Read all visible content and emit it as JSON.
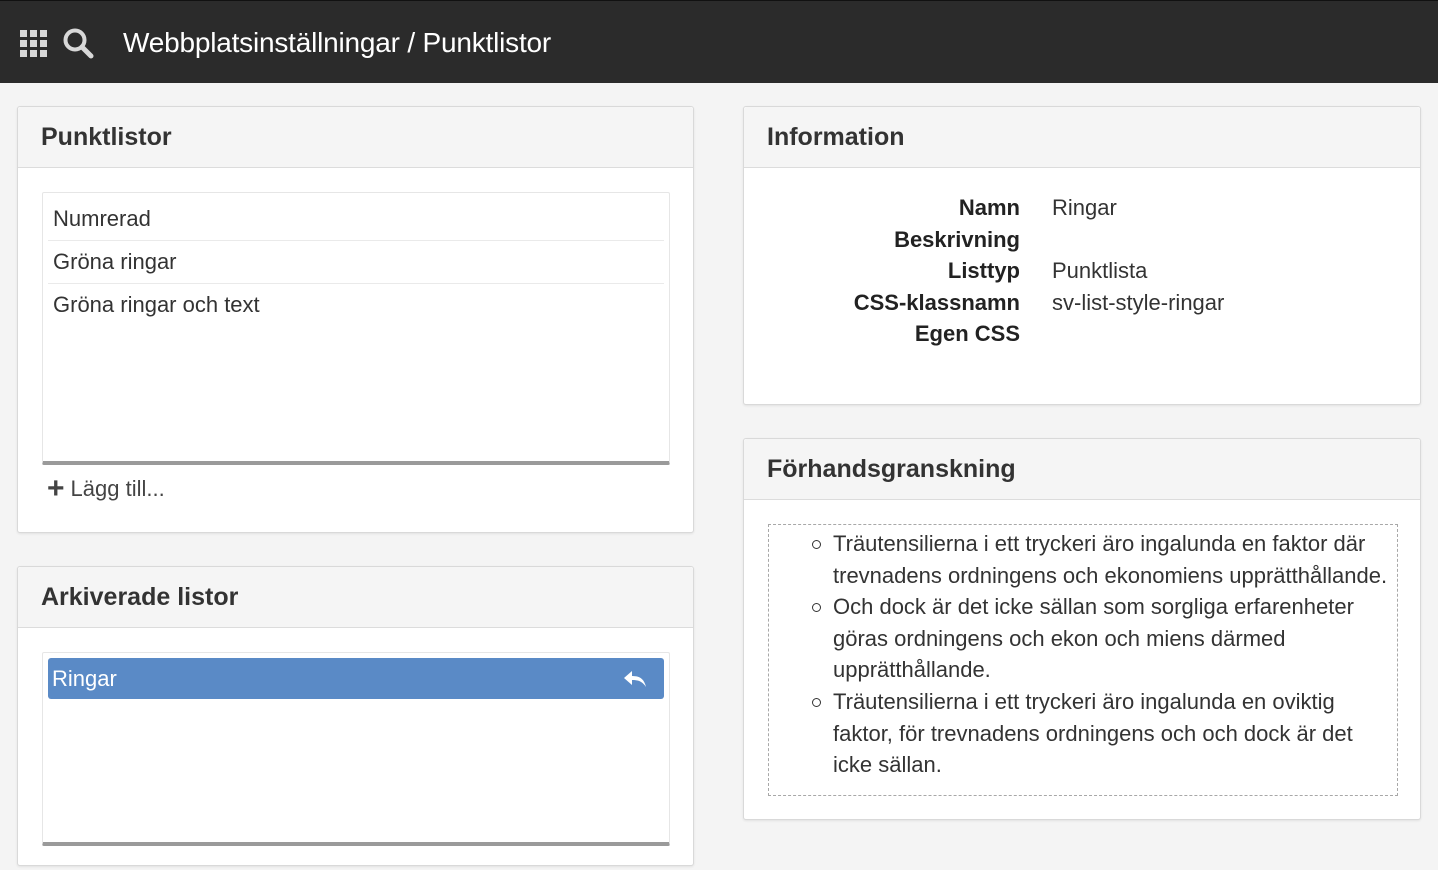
{
  "topbar": {
    "title": "Webbplatsinställningar / Punktlistor",
    "icons": [
      "grid-icon",
      "search-icon"
    ]
  },
  "lists_panel": {
    "title": "Punktlistor",
    "items": [
      "Numrerad",
      "Gröna ringar",
      "Gröna ringar och text"
    ],
    "add_label": "Lägg till..."
  },
  "archived_panel": {
    "title": "Arkiverade listor",
    "items": [
      {
        "label": "Ringar",
        "selected": true,
        "action_icon": "restore-icon"
      }
    ]
  },
  "info_panel": {
    "title": "Information",
    "rows": [
      {
        "label": "Namn",
        "value": "Ringar"
      },
      {
        "label": "Beskrivning",
        "value": ""
      },
      {
        "label": "Listtyp",
        "value": "Punktlista"
      },
      {
        "label": "CSS-klassnamn",
        "value": "sv-list-style-ringar"
      },
      {
        "label": "Egen CSS",
        "value": ""
      }
    ]
  },
  "preview_panel": {
    "title": "Förhandsgranskning",
    "bullets": [
      "Träutensilierna i ett tryckeri äro ingalunda en faktor där trevnadens ordningens och ekonomiens upprätthållande.",
      "Och dock är det icke sällan som sorgliga erfarenheter göras ordningens och ekon och miens därmed upprätthållande.",
      "Träutensilierna i ett tryckeri äro ingalunda en oviktig faktor, för trevnadens ordningens och och dock är det icke sällan."
    ]
  },
  "colors": {
    "topbar_bg": "#2b2b2b",
    "selected_item_bg": "#5a8ac6",
    "page_bg": "#f4f4f4"
  }
}
